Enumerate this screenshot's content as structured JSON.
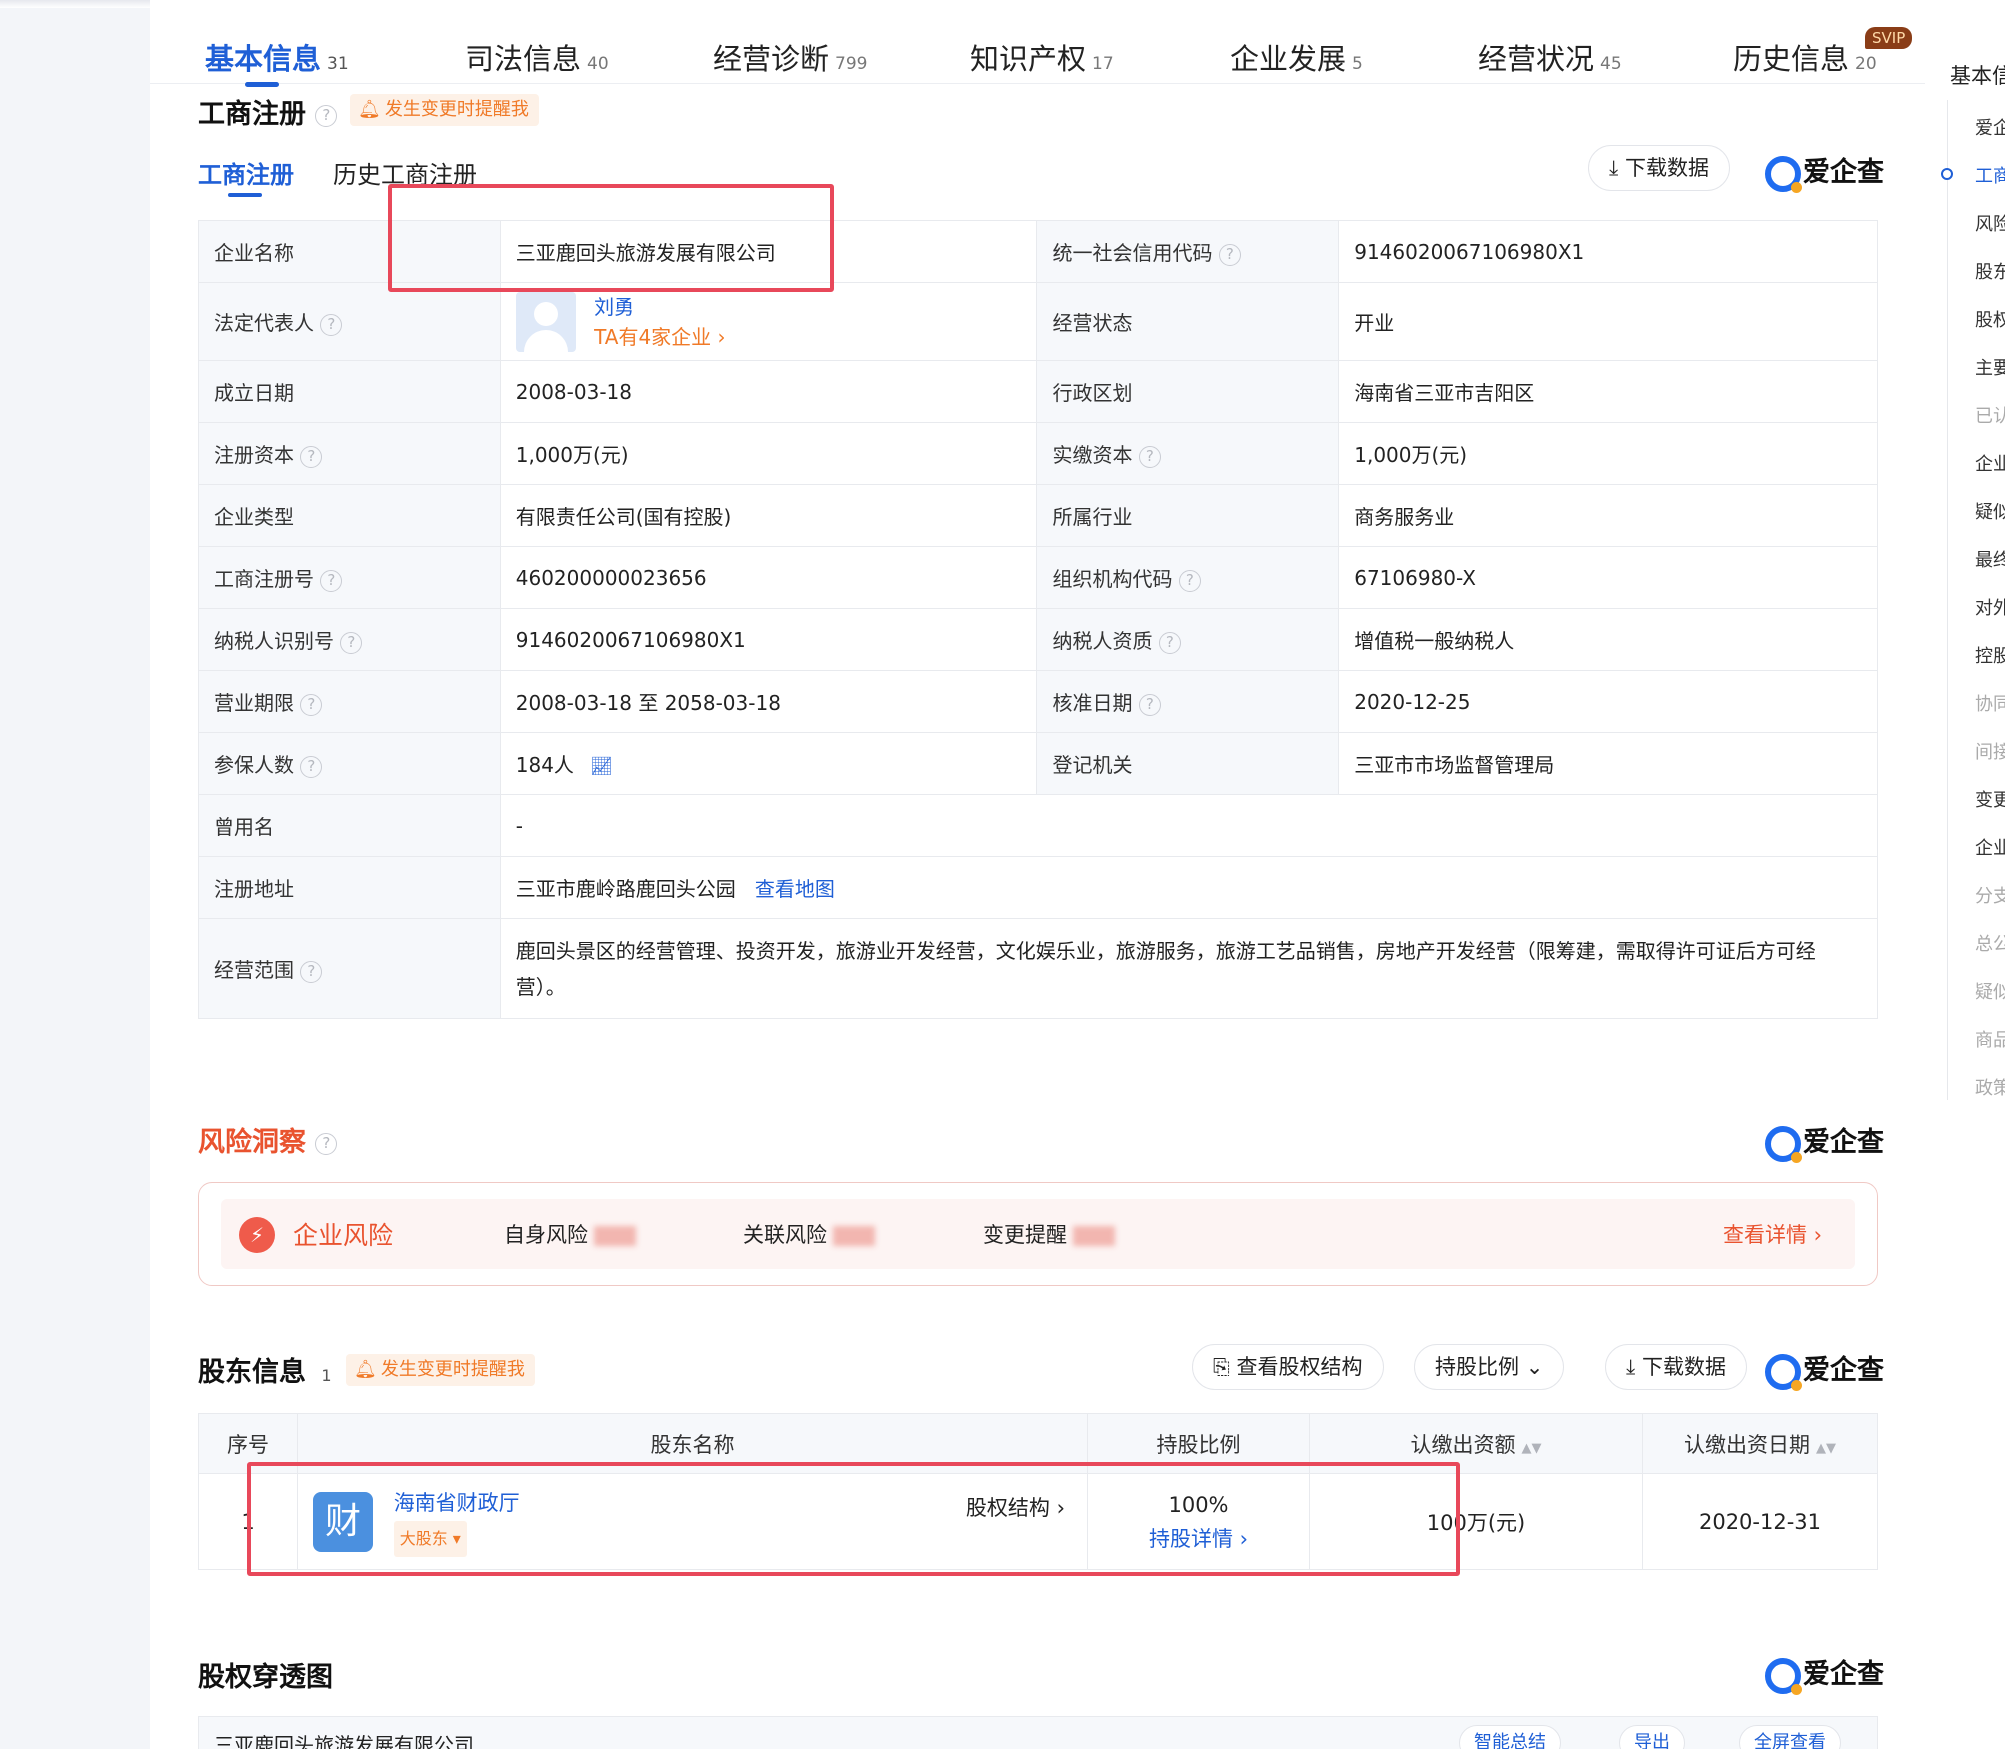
{
  "tabs": [
    {
      "label": "基本信息",
      "count": "31"
    },
    {
      "label": "司法信息",
      "count": "40"
    },
    {
      "label": "经营诊断",
      "count": "799"
    },
    {
      "label": "知识产权",
      "count": "17"
    },
    {
      "label": "企业发展",
      "count": "5"
    },
    {
      "label": "经营状况",
      "count": "45"
    },
    {
      "label": "历史信息",
      "count": "20"
    }
  ],
  "svip": "SVIP",
  "registration": {
    "title": "工商注册",
    "remind": "发生变更时提醒我",
    "subtabs": [
      "工商注册",
      "历史工商注册"
    ],
    "download": "下载数据",
    "brand": "爱企查",
    "rows": {
      "name_label": "企业名称",
      "name": "三亚鹿回头旅游发展有限公司",
      "credit_label": "统一社会信用代码",
      "credit": "9146020067106980X1",
      "legal_label": "法定代表人",
      "legal_name": "刘勇",
      "legal_link": "TA有4家企业 ›",
      "status_label": "经营状态",
      "status": "开业",
      "found_label": "成立日期",
      "found": "2008-03-18",
      "region_label": "行政区划",
      "region": "海南省三亚市吉阳区",
      "capital_label": "注册资本",
      "capital": "1,000万(元)",
      "paid_label": "实缴资本",
      "paid": "1,000万(元)",
      "type_label": "企业类型",
      "type": "有限责任公司(国有控股)",
      "industry_label": "所属行业",
      "industry": "商务服务业",
      "regno_label": "工商注册号",
      "regno": "460200000023656",
      "org_label": "组织机构代码",
      "org": "67106980-X",
      "tax_label": "纳税人识别号",
      "tax": "9146020067106980X1",
      "taxq_label": "纳税人资质",
      "taxq": "增值税一般纳税人",
      "term_label": "营业期限",
      "term": "2008-03-18 至 2058-03-18",
      "approve_label": "核准日期",
      "approve": "2020-12-25",
      "insured_label": "参保人数",
      "insured": "184人",
      "authority_label": "登记机关",
      "authority": "三亚市市场监督管理局",
      "former_label": "曾用名",
      "former": "-",
      "addr_label": "注册地址",
      "addr": "三亚市鹿岭路鹿回头公园",
      "addr_link": "查看地图",
      "scope_label": "经营范围",
      "scope": "鹿回头景区的经营管理、投资开发，旅游业开发经营，文化娱乐业，旅游服务，旅游工艺品销售，房地产开发经营（限筹建，需取得许可证后方可经营）。"
    }
  },
  "risk": {
    "title": "风险洞察",
    "brand": "爱企查",
    "icon": "shield-icon",
    "label": "企业风险",
    "items": [
      "自身风险",
      "关联风险",
      "变更提醒"
    ],
    "detail": "查看详情 ›"
  },
  "shareholders": {
    "title": "股东信息",
    "count": "1",
    "remind": "发生变更时提醒我",
    "btn_structure": "查看股权结构",
    "btn_ratio": "持股比例",
    "download": "下载数据",
    "brand": "爱企查",
    "headers": [
      "序号",
      "股东名称",
      "持股比例",
      "认缴出资额",
      "认缴出资日期"
    ],
    "row": {
      "index": "1",
      "avatar_char": "财",
      "name": "海南省财政厅",
      "tag": "大股东 ▾",
      "structure": "股权结构 ›",
      "ratio": "100%",
      "ratio_link": "持股详情 ›",
      "amount": "100万(元)",
      "date": "2020-12-31"
    }
  },
  "penetration": {
    "title": "股权穿透图",
    "brand": "爱企查",
    "row_text": "三亚鹿回头旅游发展有限公司",
    "btns": [
      "智能总结",
      "导出",
      "全屏查看"
    ]
  },
  "rightnav": {
    "title": "基本信",
    "items": [
      "爱企",
      "工商",
      "风险",
      "股东",
      "股权",
      "主要",
      "已认",
      "企业",
      "疑似",
      "最终",
      "对外",
      "控股",
      "协同",
      "间接",
      "变更",
      "企业",
      "分支",
      "总公",
      "疑似",
      "商品",
      "政策"
    ]
  },
  "colors": {
    "accent": "#1f5fd6",
    "orange": "#f07a28",
    "risk": "#ef5b4b",
    "highlight": "#e8485a"
  }
}
